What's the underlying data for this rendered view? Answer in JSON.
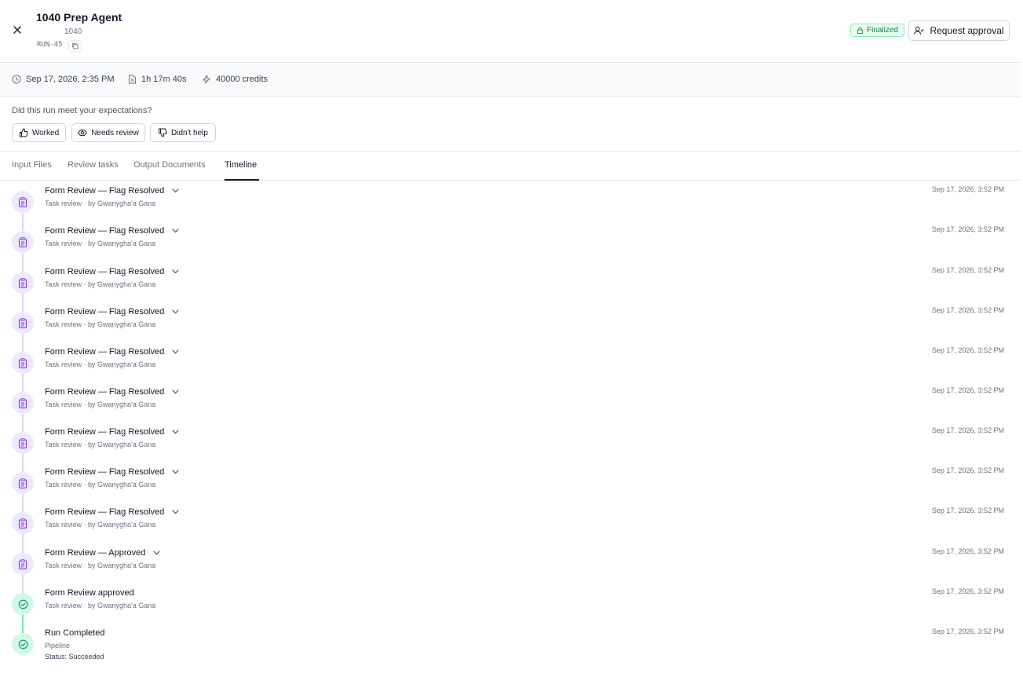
{
  "header": {
    "title": "1040 Prep Agent",
    "subtitle": "1040",
    "run_id": "RUN-45",
    "status_badge": "Finalized",
    "request_approval_label": "Request approval"
  },
  "meta": {
    "datetime": "Sep 17, 2026, 2:35 PM",
    "duration": "1h 17m 40s",
    "credits": "40000 credits"
  },
  "feedback": {
    "question": "Did this run meet your expectations?",
    "worked_label": "Worked",
    "needs_review_label": "Needs review",
    "didnt_help_label": "Didn't help"
  },
  "tabs": [
    {
      "label": "Input Files",
      "active": false
    },
    {
      "label": "Review tasks",
      "active": false
    },
    {
      "label": "Output Documents",
      "active": false
    },
    {
      "label": "Timeline",
      "active": true
    }
  ],
  "timeline": [
    {
      "title": "Form Review — Flag Resolved",
      "subtitle": "Task review · by Gwanygha'a Gana",
      "time": "Sep 17, 2026, 3:52 PM",
      "icon": "clipboard-icon",
      "expandable": true
    },
    {
      "title": "Form Review — Flag Resolved",
      "subtitle": "Task review · by Gwanygha'a Gana",
      "time": "Sep 17, 2026, 3:52 PM",
      "icon": "clipboard-icon",
      "expandable": true
    },
    {
      "title": "Form Review — Flag Resolved",
      "subtitle": "Task review · by Gwanygha'a Gana",
      "time": "Sep 17, 2026, 3:52 PM",
      "icon": "clipboard-icon",
      "expandable": true
    },
    {
      "title": "Form Review — Flag Resolved",
      "subtitle": "Task review · by Gwanygha'a Gana",
      "time": "Sep 17, 2026, 3:52 PM",
      "icon": "clipboard-icon",
      "expandable": true
    },
    {
      "title": "Form Review — Flag Resolved",
      "subtitle": "Task review · by Gwanygha'a Gana",
      "time": "Sep 17, 2026, 3:52 PM",
      "icon": "clipboard-icon",
      "expandable": true
    },
    {
      "title": "Form Review — Flag Resolved",
      "subtitle": "Task review · by Gwanygha'a Gana",
      "time": "Sep 17, 2026, 3:52 PM",
      "icon": "clipboard-icon",
      "expandable": true
    },
    {
      "title": "Form Review — Flag Resolved",
      "subtitle": "Task review · by Gwanygha'a Gana",
      "time": "Sep 17, 2026, 3:52 PM",
      "icon": "clipboard-icon",
      "expandable": true
    },
    {
      "title": "Form Review — Flag Resolved",
      "subtitle": "Task review · by Gwanygha'a Gana",
      "time": "Sep 17, 2026, 3:52 PM",
      "icon": "clipboard-icon",
      "expandable": true
    },
    {
      "title": "Form Review — Flag Resolved",
      "subtitle": "Task review · by Gwanygha'a Gana",
      "time": "Sep 17, 2026, 3:52 PM",
      "icon": "clipboard-icon",
      "expandable": true
    },
    {
      "title": "Form Review — Approved",
      "subtitle": "Task review · by Gwanygha'a Gana",
      "time": "Sep 17, 2026, 3:52 PM",
      "icon": "clipboard-icon",
      "expandable": true
    },
    {
      "title": "Form Review approved",
      "subtitle": "Task review · by Gwanygha'a Gana",
      "time": "Sep 17, 2026, 3:52 PM",
      "icon": "check-circle-icon",
      "expandable": false
    },
    {
      "title": "Run Completed",
      "subtitle": "Pipeline",
      "subtitle2": "Status: Succeeded",
      "time": "Sep 17, 2026, 3:52 PM",
      "icon": "check-circle-icon",
      "expandable": false
    }
  ],
  "colors": {
    "purple_icon": "#7c3aed",
    "purple_bg": "#ede9fe",
    "green_icon": "#059669",
    "green_bg": "#d1fae5",
    "finalized_text": "#15803d"
  }
}
